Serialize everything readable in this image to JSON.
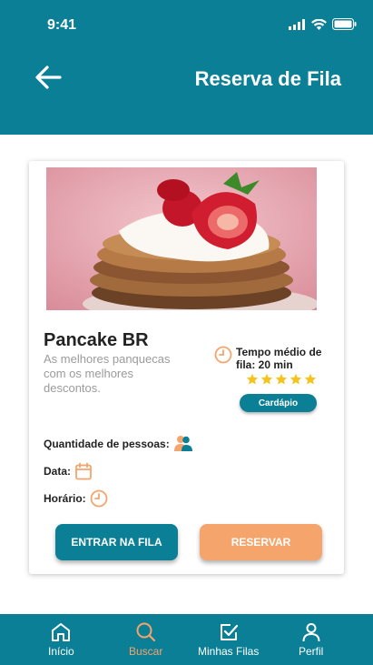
{
  "status_bar": {
    "time": "9:41"
  },
  "header": {
    "title": "Reserva de Fila"
  },
  "restaurant": {
    "name": "Pancake BR",
    "description": "As melhores panquecas com os melhores descontos.",
    "wait_time": "Tempo médio de fila: 20 min",
    "rating": 5,
    "menu_button": "Cardápio"
  },
  "form": {
    "people_label": "Quantidade de pessoas:",
    "date_label": "Data:",
    "time_label": "Horário:"
  },
  "actions": {
    "enter_queue": "ENTRAR NA FILA",
    "reserve": "RESERVAR"
  },
  "bottom_nav": {
    "items": [
      {
        "label": "Início",
        "icon": "home-icon"
      },
      {
        "label": "Buscar",
        "icon": "search-icon",
        "active": true
      },
      {
        "label": "Minhas Filas",
        "icon": "checkbox-icon"
      },
      {
        "label": "Perfil",
        "icon": "user-icon"
      }
    ]
  },
  "colors": {
    "primary": "#0a7f96",
    "accent": "#f5a46c",
    "star": "#f7c21a"
  }
}
